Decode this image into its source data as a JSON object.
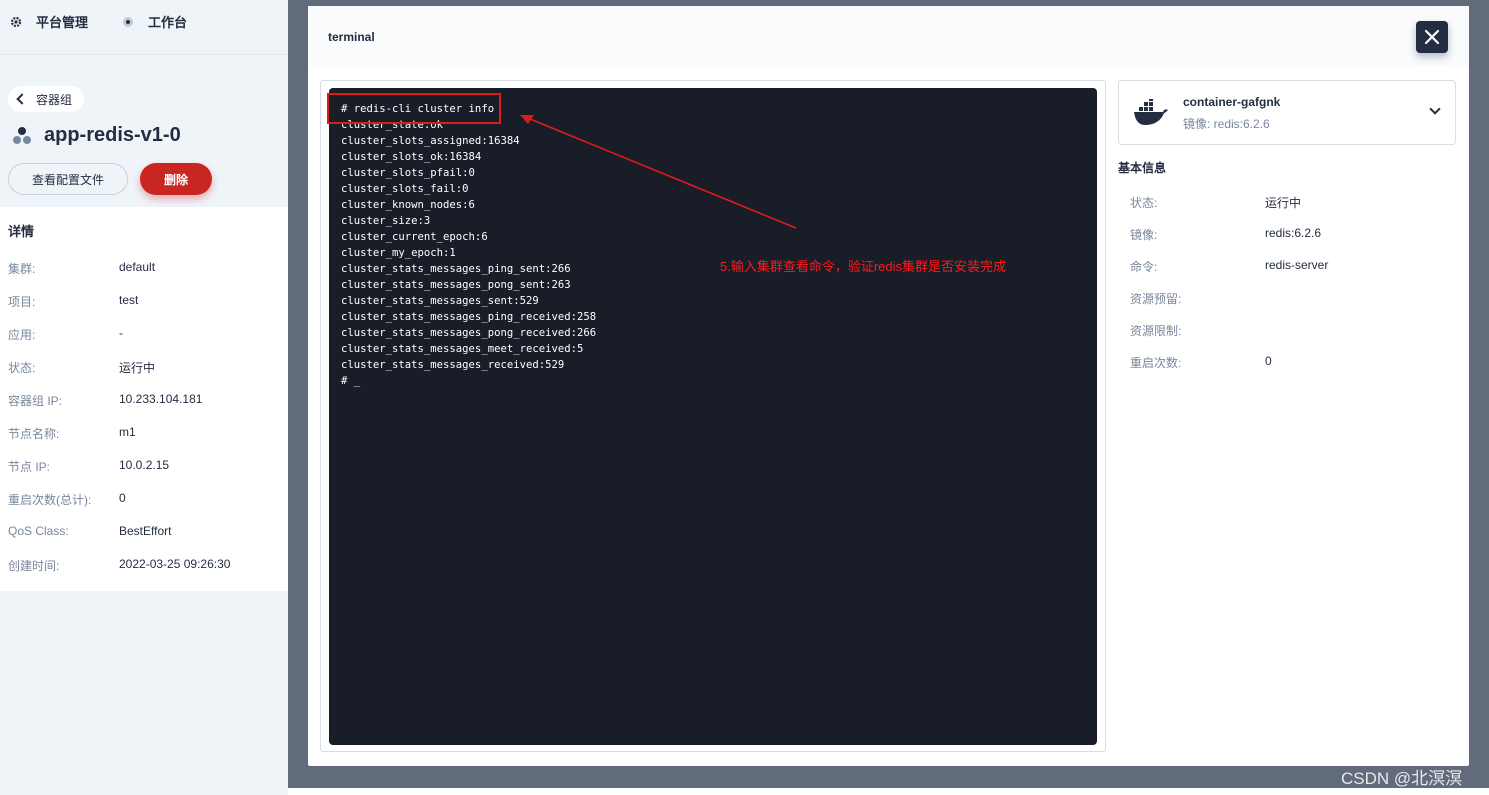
{
  "topnav": {
    "platform": "平台管理",
    "workbench": "工作台"
  },
  "back_label": "容器组",
  "pod_name": "app-redis-v1-0",
  "buttons": {
    "view_config": "查看配置文件",
    "delete": "删除"
  },
  "details": {
    "title": "详情",
    "rows": [
      {
        "k": "集群:",
        "v": "default"
      },
      {
        "k": "项目:",
        "v": "test"
      },
      {
        "k": "应用:",
        "v": "-"
      },
      {
        "k": "状态:",
        "v": "运行中"
      },
      {
        "k": "容器组 IP:",
        "v": "10.233.104.181"
      },
      {
        "k": "节点名称:",
        "v": "m1"
      },
      {
        "k": "节点 IP:",
        "v": "10.0.2.15"
      },
      {
        "k": "重启次数(总计):",
        "v": "0"
      },
      {
        "k": "QoS Class:",
        "v": "BestEffort"
      },
      {
        "k": "创建时间:",
        "v": "2022-03-25 09:26:30"
      }
    ]
  },
  "modal": {
    "title": "terminal"
  },
  "terminal": {
    "lines": [
      "# redis-cli cluster info",
      "cluster_state:ok",
      "cluster_slots_assigned:16384",
      "cluster_slots_ok:16384",
      "cluster_slots_pfail:0",
      "cluster_slots_fail:0",
      "cluster_known_nodes:6",
      "cluster_size:3",
      "cluster_current_epoch:6",
      "cluster_my_epoch:1",
      "cluster_stats_messages_ping_sent:266",
      "cluster_stats_messages_pong_sent:263",
      "cluster_stats_messages_sent:529",
      "cluster_stats_messages_ping_received:258",
      "cluster_stats_messages_pong_received:266",
      "cluster_stats_messages_meet_received:5",
      "cluster_stats_messages_received:529",
      "# _"
    ]
  },
  "annotation": "5.输入集群查看命令，验证redis集群是否安装完成",
  "container": {
    "name": "container-gafgnk",
    "image": "镜像: redis:6.2.6"
  },
  "basic_info": {
    "title": "基本信息",
    "rows": [
      {
        "k": "状态:",
        "v": "运行中"
      },
      {
        "k": "镜像:",
        "v": "redis:6.2.6"
      },
      {
        "k": "命令:",
        "v": "redis-server"
      },
      {
        "k": "资源预留:",
        "v": ""
      },
      {
        "k": "资源限制:",
        "v": ""
      },
      {
        "k": "重启次数:",
        "v": "0"
      }
    ]
  },
  "watermark": "CSDN @北溟溟"
}
